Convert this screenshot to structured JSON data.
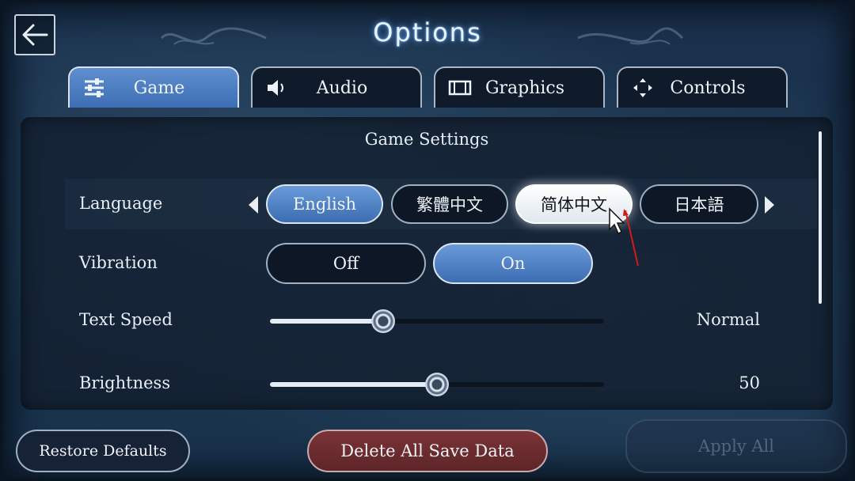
{
  "header": {
    "title": "Options",
    "back_icon": "arrow-left-icon"
  },
  "tabs": [
    {
      "label": "Game",
      "icon": "sliders-icon",
      "active": true
    },
    {
      "label": "Audio",
      "icon": "speaker-icon",
      "active": false
    },
    {
      "label": "Graphics",
      "icon": "display-icon",
      "active": false
    },
    {
      "label": "Controls",
      "icon": "move-arrows-icon",
      "active": false
    }
  ],
  "panel": {
    "title": "Game Settings",
    "language": {
      "label": "Language",
      "options": [
        "English",
        "繁體中文",
        "简体中文",
        "日本語"
      ],
      "selected": "English",
      "hovered": "简体中文"
    },
    "vibration": {
      "label": "Vibration",
      "options": [
        "Off",
        "On"
      ],
      "selected": "On"
    },
    "text_speed": {
      "label": "Text Speed",
      "value_text": "Normal",
      "level": 0.34
    },
    "brightness": {
      "label": "Brightness",
      "value_text": "50",
      "level": 0.5
    }
  },
  "footer": {
    "restore_label": "Restore Defaults",
    "delete_label": "Delete All Save Data",
    "apply_label": "Apply All"
  },
  "colors": {
    "accent": "#4a7bc0",
    "danger": "#6e2c2f",
    "panel": "#121e2e"
  }
}
